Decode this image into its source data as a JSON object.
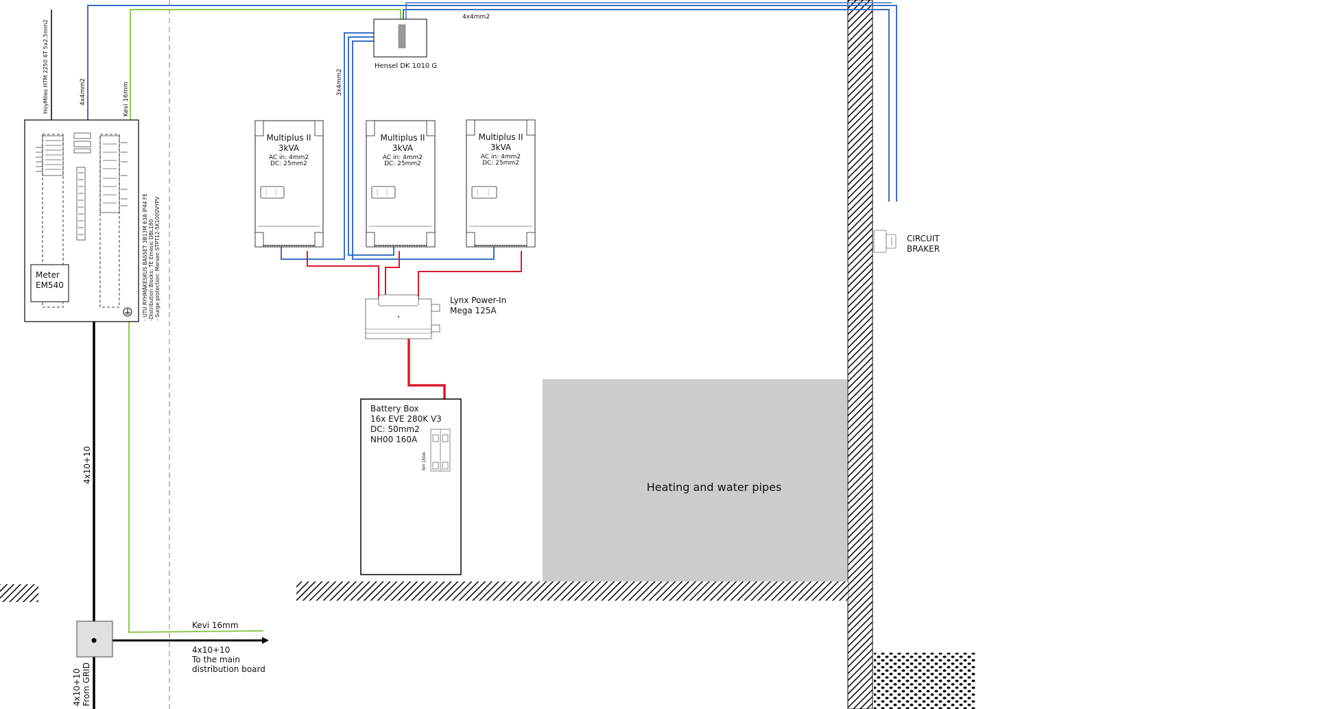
{
  "colors": {
    "blue_wire": "#3a6fc4",
    "green_wire": "#8cc84b",
    "red_wire": "#d91a2a",
    "black_wire": "#000000",
    "obstacle_fill": "#cccccc",
    "box_stroke": "#222222"
  },
  "icons": {
    "ground": "ground-symbol-icon",
    "inverter_display": "display-panel-icon",
    "fuse": "fuse-icon"
  },
  "distribution_board": {
    "meter_line1": "Meter",
    "meter_line2": "EM540",
    "notes": [
      "- UTU RYHMÄKESKUS BASSET 3B13M 63A IP44 FE",
      "-Distribution Blocks: TE Emesic DBL180",
      "- Surge protection: Mersen STPT12-5K1000VYPV"
    ]
  },
  "cable_labels": {
    "hoymiles": "HoyMiles HTM 2250 6T 5x2.5mm2",
    "feed_4x4": "4x4mm2",
    "kevi_vertical": "Kevi 16mm",
    "top_4x4": "4x4mm2",
    "feed_3x4": "3x4mm2",
    "grid_vertical": "4x10+10",
    "kevi_horizontal": "Kevi 16mm",
    "from_grid_line1": "4x10+10",
    "from_grid_line2": "From GRID",
    "to_main_line1": "4x10+10",
    "to_main_line2": "To the main",
    "to_main_line3": "distribution board"
  },
  "hensel": {
    "label": "Hensel DK 1010 G"
  },
  "inverters": [
    {
      "title1": "Multiplus II",
      "title2": "3kVA",
      "ac": "AC in: 4mm2",
      "dc": "DC: 25mm2"
    },
    {
      "title1": "Multiplus II",
      "title2": "3kVA",
      "ac": "AC in: 4mm2",
      "dc": "DC: 25mm2"
    },
    {
      "title1": "Multiplus II",
      "title2": "3kVA",
      "ac": "AC in: 4mm2",
      "dc": "DC: 25mm2"
    }
  ],
  "lynx": {
    "line1": "Lynx Power-In",
    "line2": "Mega 125A"
  },
  "battery": {
    "line1": "Battery Box",
    "line2": "16x EVE 280K V3",
    "line3": "DC: 50mm2",
    "line4": "NH00 160A",
    "fuse_label": "NH 160A"
  },
  "obstacle": {
    "label": "Heating and water pipes"
  },
  "breaker": {
    "line1": "CIRCUIT",
    "line2": "BRAKER"
  }
}
